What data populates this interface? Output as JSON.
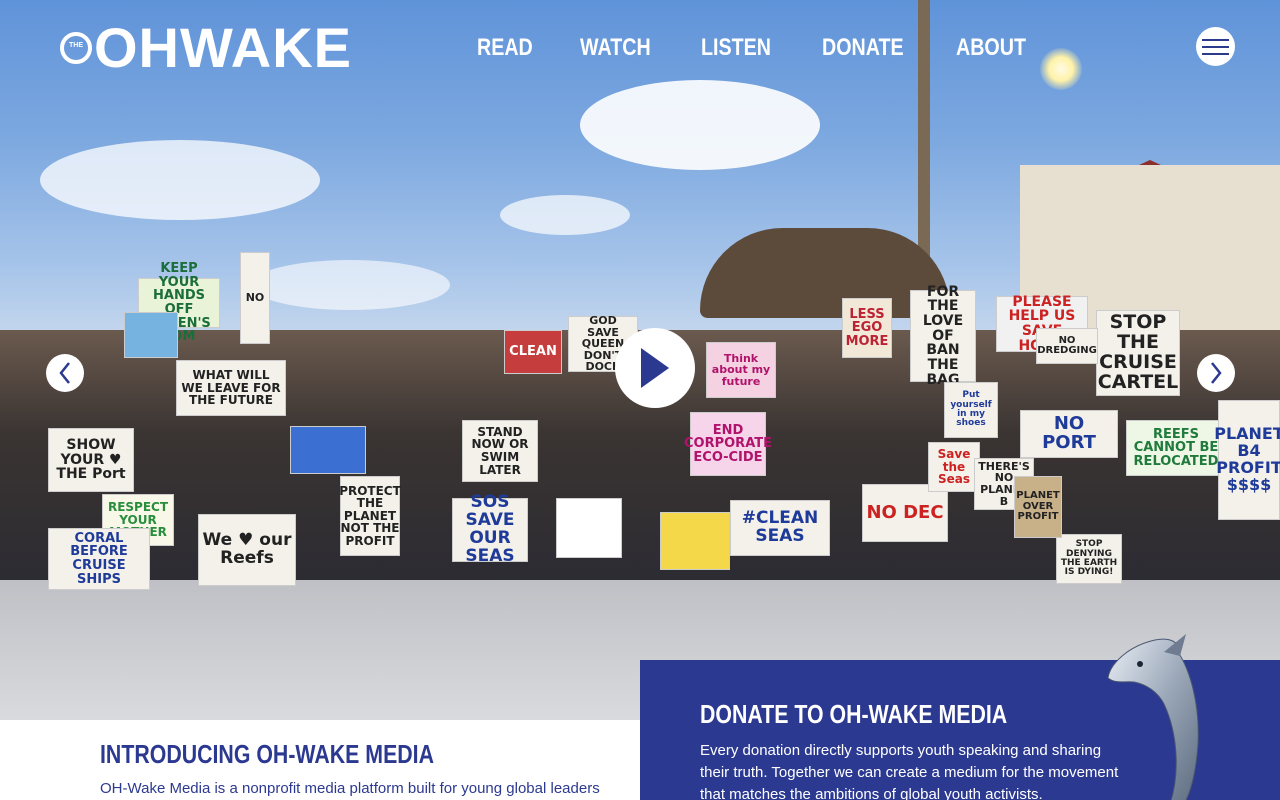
{
  "header": {
    "logo_small": "THE",
    "logo_main": "OHWAKE",
    "nav": [
      "READ",
      "WATCH",
      "LISTEN",
      "DONATE",
      "ABOUT"
    ],
    "menu_icon": "hamburger-menu-icon"
  },
  "hero": {
    "signs": [
      "KEEP YOUR HANDS OFF QUEEN'S TOM",
      "NO",
      "SHOW YOUR ♥ THE Port",
      "WHAT WILL WE LEAVE FOR THE FUTURE",
      "CLEAN",
      "GOD SAVE QUEEN DON'T DOCK",
      "STAND NOW OR SWIM LATER",
      "LESS EGO MORE",
      "FOR THE LOVE OF BAN THE BAG",
      "PLEASE HELP US SAVE HOME",
      "STOP THE CRUISE CARTEL",
      "END CORPORATE ECO-CIDE",
      "We ♥ our Reefs",
      "PROTECT THE PLANET NOT THE PROFIT",
      "SOS SAVE OUR SEAS",
      "#CLEAN SEAS",
      "NO DEC",
      "REEFS CANNOT BE RELOCATED",
      "PLANET B4 PROFIT $$$$",
      "RESPECT YOUR MOTHER",
      "CORAL BEFORE CRUISE SHIPS",
      "STOP DENYING THE EARTH IS DYING!",
      "Save the Seas",
      "THERE'S NO PLANET B",
      "PLANET OVER PROFIT",
      "NO PORT",
      "Think about my future",
      "Put yourself in my shoes",
      "NO DREDGING"
    ],
    "prev_icon": "chevron-left-icon",
    "next_icon": "chevron-right-icon",
    "play_icon": "play-icon"
  },
  "intro": {
    "title": "INTRODUCING OH-WAKE MEDIA",
    "text": "OH-Wake Media is a nonprofit media platform built for young global leaders"
  },
  "donate": {
    "title": "DONATE TO OH-WAKE MEDIA",
    "text": "Every donation directly supports youth speaking and sharing their truth. Together we can create a medium for the movement that matches the ambitions of global youth activists."
  },
  "colors": {
    "brand_blue": "#2b3991",
    "white": "#ffffff"
  }
}
